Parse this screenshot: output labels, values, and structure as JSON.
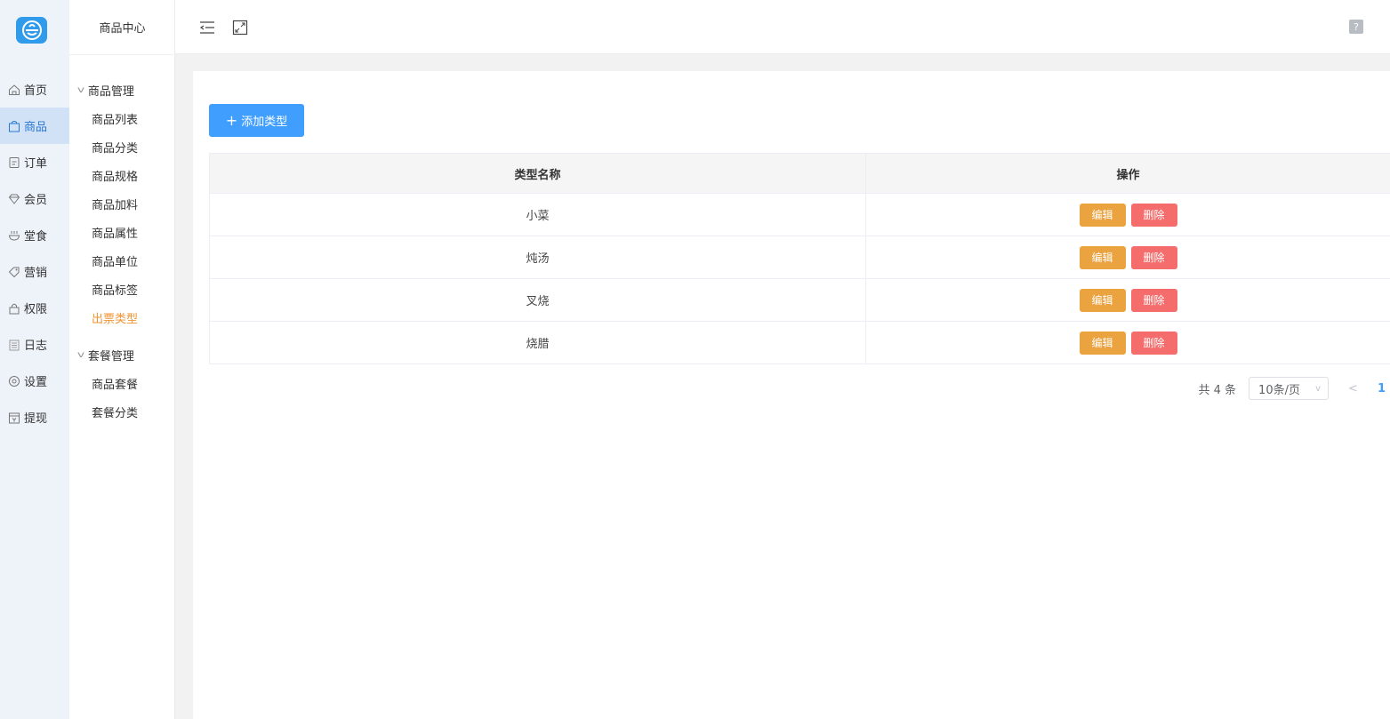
{
  "sidebar": {
    "items": [
      {
        "label": "首页",
        "icon": "home-icon"
      },
      {
        "label": "商品",
        "icon": "bag-icon",
        "active": true
      },
      {
        "label": "订单",
        "icon": "order-icon"
      },
      {
        "label": "会员",
        "icon": "diamond-icon"
      },
      {
        "label": "堂食",
        "icon": "dine-in-icon"
      },
      {
        "label": "营销",
        "icon": "tag-icon"
      },
      {
        "label": "权限",
        "icon": "lock-icon"
      },
      {
        "label": "日志",
        "icon": "log-icon"
      },
      {
        "label": "设置",
        "icon": "settings-icon"
      },
      {
        "label": "提现",
        "icon": "withdraw-icon"
      }
    ]
  },
  "submenu": {
    "title": "商品中心",
    "group1": {
      "label": "商品管理",
      "items": [
        "商品列表",
        "商品分类",
        "商品规格",
        "商品加料",
        "商品属性",
        "商品单位",
        "商品标签",
        "出票类型"
      ]
    },
    "group2": {
      "label": "套餐管理",
      "items": [
        "商品套餐",
        "套餐分类"
      ]
    },
    "active_item": "出票类型"
  },
  "toolbar": {
    "add_label": "添加类型"
  },
  "table": {
    "columns": [
      "类型名称",
      "操作"
    ],
    "rows": [
      {
        "name": "小菜"
      },
      {
        "name": "炖汤"
      },
      {
        "name": "叉烧"
      },
      {
        "name": "烧腊"
      }
    ],
    "edit_label": "编辑",
    "delete_label": "删除"
  },
  "pagination": {
    "total": "共 4 条",
    "page_size": "10条/页",
    "current_page": "1"
  },
  "colors": {
    "primary": "#409eff",
    "edit": "#eaa33f",
    "delete": "#f56c6c",
    "active_menu": "#f29433"
  }
}
